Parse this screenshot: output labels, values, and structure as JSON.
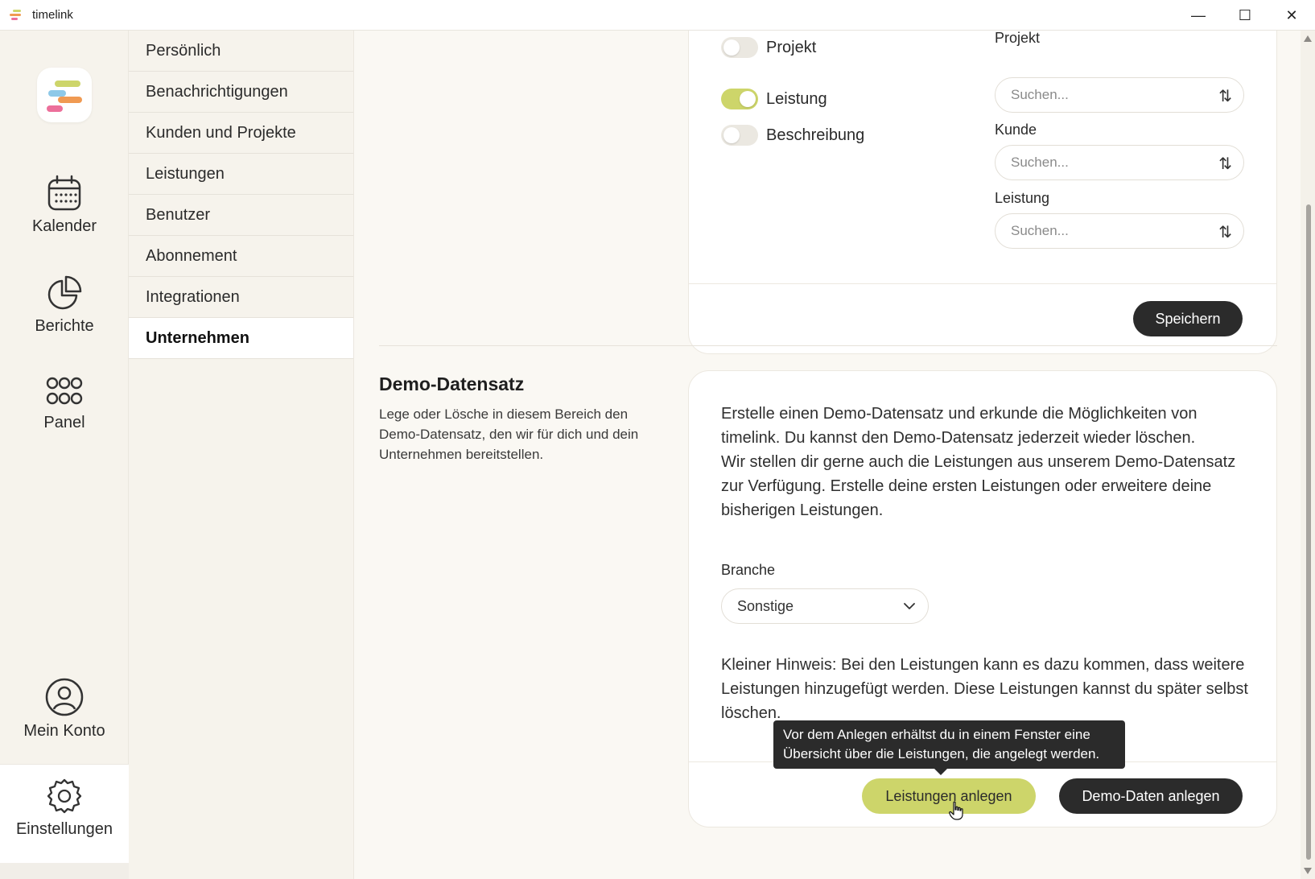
{
  "window": {
    "title": "timelink",
    "minimize": "—",
    "maximize": "☐",
    "close": "✕"
  },
  "colors": {
    "accent": "#cdd56a",
    "dark": "#2b2b2b",
    "logo_green": "#cdd56a",
    "logo_orange": "#f09a52",
    "logo_pink": "#ec6f9a",
    "logo_blue": "#8ec9e8"
  },
  "leftnav": {
    "items": [
      {
        "label": "Kalender",
        "icon": "calendar-icon"
      },
      {
        "label": "Berichte",
        "icon": "pie-chart-icon"
      },
      {
        "label": "Panel",
        "icon": "grid-icon"
      },
      {
        "label": "Mein Konto",
        "icon": "user-circle-icon"
      },
      {
        "label": "Einstellungen",
        "icon": "gear-icon"
      }
    ]
  },
  "submenu": {
    "items": [
      "Persönlich",
      "Benachrichtigungen",
      "Kunden und Projekte",
      "Leistungen",
      "Benutzer",
      "Abonnement",
      "Integrationen",
      "Unternehmen"
    ],
    "active": "Unternehmen"
  },
  "top_card": {
    "toggles": [
      {
        "label": "Projekt",
        "on": false
      },
      {
        "label": "Leistung",
        "on": true
      },
      {
        "label": "Beschreibung",
        "on": false
      }
    ],
    "fields": [
      {
        "label": "Projekt",
        "placeholder": "Suchen..."
      },
      {
        "label": "Kunde",
        "placeholder": "Suchen..."
      },
      {
        "label": "Leistung",
        "placeholder": "Suchen..."
      }
    ],
    "sort_icon": "⇅",
    "save_label": "Speichern"
  },
  "demo": {
    "title": "Demo-Datensatz",
    "description": "Lege oder Lösche in diesem Bereich den Demo-Datensatz, den wir für dich und dein Unternehmen bereitstellen.",
    "intro_lines": [
      "Erstelle einen Demo-Datensatz und erkunde die Möglichkeiten von",
      "timelink. Du kannst den Demo-Datensatz jederzeit wieder löschen.",
      "Wir stellen dir gerne auch die Leistungen aus unserem Demo-Datensatz",
      "zur Verfügung. Erstelle deine ersten Leistungen oder erweitere deine",
      "bisherigen Leistungen."
    ],
    "branche_label": "Branche",
    "branche_value": "Sonstige",
    "hint_lines": [
      "Kleiner Hinweis: Bei den Leistungen kann es dazu kommen, dass weitere",
      "Leistungen hinzugefügt werden. Diese Leistungen kannst du später selbst",
      "löschen."
    ],
    "tooltip_lines": [
      "Vor dem Anlegen erhältst du in einem Fenster eine",
      "Übersicht über die Leistungen, die angelegt werden."
    ],
    "create_services_label": "Leistungen anlegen",
    "create_demo_label": "Demo-Daten anlegen"
  }
}
